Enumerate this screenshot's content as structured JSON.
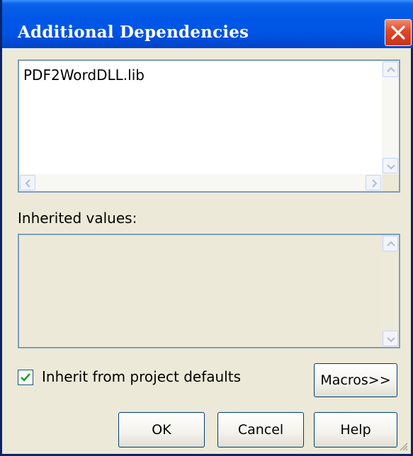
{
  "dialog": {
    "title": "Additional Dependencies",
    "title_bar_color": "#0054E3",
    "close_button_color": "#E0462A"
  },
  "dependencies_list": {
    "items": [
      "PDF2WordDLL.lib"
    ]
  },
  "inherited_values": {
    "label": "Inherited values:",
    "items": []
  },
  "inherit_checkbox": {
    "label": "Inherit from project defaults",
    "checked": true
  },
  "buttons": {
    "macros": "Macros>>",
    "ok": "OK",
    "cancel": "Cancel",
    "help": "Help"
  }
}
